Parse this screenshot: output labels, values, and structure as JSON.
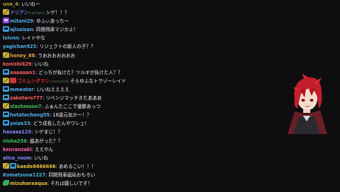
{
  "chat": {
    "messages": [
      {
        "user": "una_4",
        "alt": "",
        "color": "#b8a032",
        "badges": [],
        "text": "いいねー"
      },
      {
        "user": "ドリアン",
        "alt": "hantan",
        "color": "#6f7be0",
        "badges": [
          "sword"
        ],
        "text": "シゲ！！？"
      },
      {
        "user": "mitani29",
        "alt": "",
        "color": "#4fb0e8",
        "badges": [
          "tv"
        ],
        "text": "ゆふぃあっちー"
      },
      {
        "user": "ajisaisan",
        "alt": "",
        "color": "#4fb0e8",
        "badges": [
          "screen"
        ],
        "text": "四開飛車マジかよ！"
      },
      {
        "user": "lxivnn",
        "alt": "",
        "color": "#4fb0e8",
        "badges": [],
        "text": "レイドやな"
      },
      {
        "user": "yagichan925",
        "alt": "",
        "color": "#4fb0e8",
        "badges": [],
        "text": "リジェクトの新人の子？？"
      },
      {
        "user": "honey_88",
        "alt": "",
        "color": "#e8a23a",
        "badges": [
          "sword"
        ],
        "text": "うおおおおおおお"
      },
      {
        "user": "konishi629",
        "alt": "",
        "color": "#ff5f5f",
        "badges": [],
        "text": "いいね"
      },
      {
        "user": "aaaaaan1",
        "alt": "",
        "color": "#ff5f5f",
        "badges": [
          "screen"
        ],
        "text": "どっちが負けた？ツルギが負けた人？？"
      },
      {
        "user": "ゴミムシダマシ",
        "alt": "ohmushi",
        "color": "#e02a2a",
        "badges": [
          "sword",
          "gift"
        ],
        "text": "そらゆふなトラゾーレイド"
      },
      {
        "user": "mmeater",
        "alt": "",
        "color": "#4fb0e8",
        "badges": [
          "screen"
        ],
        "text": "いいねええええ"
      },
      {
        "user": "zakotaro777",
        "alt": "",
        "color": "#ff5f5f",
        "badges": [
          "screen"
        ],
        "text": "リベンジマッチきたあああ"
      },
      {
        "user": "slashmoon7",
        "alt": "",
        "color": "#3fbf5a",
        "badges": [
          "sword"
        ],
        "text": "ふぁんたここで優勝あっつ"
      },
      {
        "user": "hotatechang55",
        "alt": "",
        "color": "#4fb0e8",
        "badges": [
          "screen"
        ],
        "text": "18歳元気かー！？"
      },
      {
        "user": "yoize33",
        "alt": "",
        "color": "#4fb0e8",
        "badges": [
          "screen"
        ],
        "text": "どう成長したんやワレェ!"
      },
      {
        "user": "hasaaa125",
        "alt": "",
        "color": "#8a8aff",
        "badges": [],
        "text": "シゲまじ！？"
      },
      {
        "user": "nisha256",
        "alt": "",
        "color": "#3fbf5a",
        "badges": [],
        "text": "脇あがった？？"
      },
      {
        "user": "kenranzaki",
        "alt": "",
        "color": "#ff5fb0",
        "badges": [],
        "text": "ええやん"
      },
      {
        "user": "alice_room",
        "alt": "",
        "color": "#8a8aff",
        "badges": [],
        "text": "いいね"
      },
      {
        "user": "kaede6666666",
        "alt": "",
        "color": "#e8c23a",
        "badges": [
          "sword",
          "screen"
        ],
        "text": "あめるこい！！！"
      },
      {
        "user": "Komatsuna1227",
        "alt": "",
        "color": "#4fb0e8",
        "badges": [],
        "text": "四開飛車組局おもろい"
      },
      {
        "user": "mizuharaaqua",
        "alt": "",
        "color": "#e8c23a",
        "badges": [
          "leaf"
        ],
        "text": "それは嬉しいです！"
      }
    ]
  },
  "avatar": {
    "name": "avatar-character"
  },
  "colors": {
    "background": "#0e0e10",
    "text": "#efeff1"
  }
}
